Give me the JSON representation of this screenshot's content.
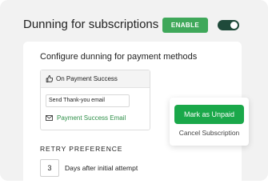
{
  "header": {
    "title": "Dunning for subscriptions",
    "enable_label": "ENABLE",
    "toggle_state": "on"
  },
  "card": {
    "title": "Configure dunning for payment methods",
    "success_box": {
      "header_label": "On Payment Success",
      "email_field_value": "Send Thank-you email",
      "email_link_label": "Payment Success Email"
    },
    "retry": {
      "label": "RETRY PREFERENCE",
      "days_value": "3",
      "days_label": "Days after initial attempt"
    }
  },
  "popup": {
    "mark_unpaid_label": "Mark as Unpaid",
    "cancel_label": "Cancel Subscription"
  },
  "colors": {
    "accent_green": "#3fa85a",
    "toggle_dark": "#1f4a3a",
    "link_green": "#2e8f48",
    "button_green": "#1aa84a"
  },
  "icons": [
    "thumbs-up-icon",
    "mail-icon"
  ]
}
